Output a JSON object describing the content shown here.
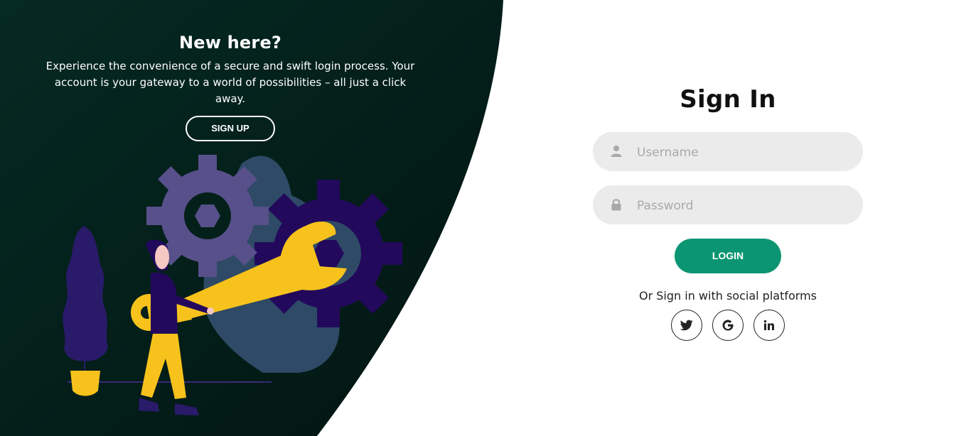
{
  "left_panel": {
    "title": "New here?",
    "description": "Experience the convenience of a secure and swift login process. Your account is your gateway to a world of possibilities – all just a click away.",
    "signup_label": "SIGN UP"
  },
  "signin": {
    "title": "Sign In",
    "username_placeholder": "Username",
    "password_placeholder": "Password",
    "login_label": "LOGIN",
    "social_text": "Or Sign in with social platforms",
    "social_icons": [
      "twitter-icon",
      "google-icon",
      "linkedin-icon"
    ]
  },
  "colors": {
    "panel_dark": "#03201b",
    "accent_green": "#0c9572",
    "input_bg": "#ebebeb"
  }
}
